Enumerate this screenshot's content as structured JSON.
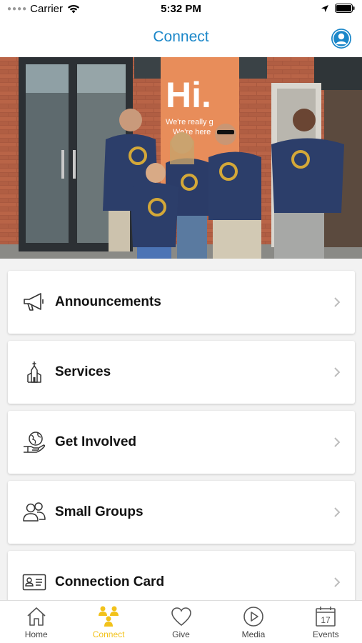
{
  "status_bar": {
    "carrier": "Carrier",
    "time": "5:32 PM"
  },
  "nav": {
    "title": "Connect",
    "title_color": "#1b87c9"
  },
  "hero": {
    "banner_text": "Hi.",
    "banner_subtext_1": "We're really g",
    "banner_subtext_2": "We're here"
  },
  "menu": {
    "items": [
      {
        "label": "Announcements",
        "icon": "megaphone-icon"
      },
      {
        "label": "Services",
        "icon": "church-icon"
      },
      {
        "label": "Get Involved",
        "icon": "globe-hand-icon"
      },
      {
        "label": "Small Groups",
        "icon": "people-icon"
      },
      {
        "label": "Connection Card",
        "icon": "id-card-icon"
      }
    ]
  },
  "tabs": [
    {
      "label": "Home",
      "icon": "home-icon",
      "active": false
    },
    {
      "label": "Connect",
      "icon": "connect-people-icon",
      "active": true
    },
    {
      "label": "Give",
      "icon": "heart-icon",
      "active": false
    },
    {
      "label": "Media",
      "icon": "play-icon",
      "active": false
    },
    {
      "label": "Events",
      "icon": "calendar-icon",
      "active": false
    }
  ],
  "calendar_day": "17",
  "colors": {
    "accent_blue": "#1b87c9",
    "active_tab": "#f2c21b",
    "shirt_logo": "#d4a838"
  }
}
